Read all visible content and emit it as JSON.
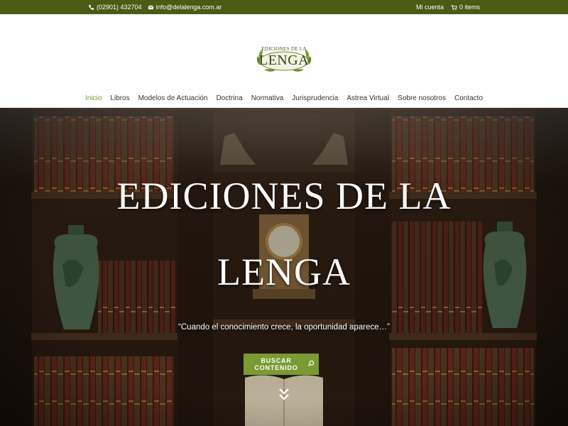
{
  "topbar": {
    "phone": "(02901) 432704",
    "email": "info@delalenga.com.ar",
    "account": "Mi cuenta",
    "cart": "0 items",
    "icons": {
      "phone": "phone-icon",
      "email": "envelope-icon",
      "cart": "cart-icon"
    },
    "bg_color": "#4b5a14"
  },
  "logo": {
    "line1": "EDICIONES DE LA",
    "line2": "LENGA"
  },
  "nav": {
    "items": [
      {
        "label": "Inicio",
        "active": true
      },
      {
        "label": "Libros"
      },
      {
        "label": "Modelos de Actuación"
      },
      {
        "label": "Doctrina"
      },
      {
        "label": "Normativa"
      },
      {
        "label": "Jurisprudencia"
      },
      {
        "label": "Astrea Virtual"
      },
      {
        "label": "Sobre nosotros"
      },
      {
        "label": "Contacto"
      }
    ],
    "active_color": "#7a9a33"
  },
  "hero": {
    "title_line1": "EDICIONES DE LA",
    "title_line2": "LENGA",
    "quote": "“Cuando el conocimiento crece, la oportunidad aparece…”",
    "cta_label": "BUSCAR CONTENIDO",
    "cta_icon": "search-icon",
    "scroll_icon": "double-chevron-down-icon",
    "cta_color": "#7a9a33"
  }
}
